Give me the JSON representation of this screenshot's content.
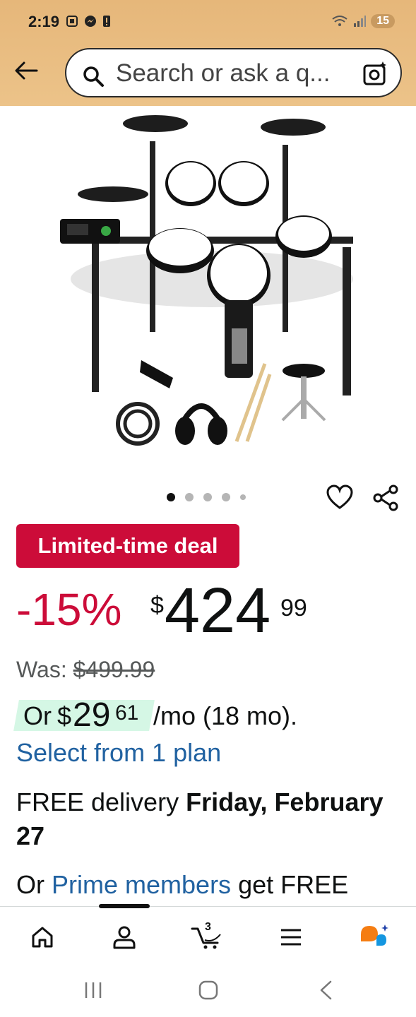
{
  "status_bar": {
    "time": "2:19",
    "battery": "15"
  },
  "search": {
    "placeholder": "Search or ask a q..."
  },
  "gallery": {
    "dot_count": 5,
    "active_index": 0
  },
  "deal": {
    "badge": "Limited-time deal",
    "discount": "-15%",
    "currency": "$",
    "price_whole": "424",
    "price_fraction": "99",
    "was_label": "Was:",
    "was_price": "$499.99"
  },
  "monthly": {
    "or": "Or",
    "currency": "$",
    "whole": "29",
    "fraction": "61",
    "term": "/mo (18 mo)."
  },
  "plan_link": "Select from 1 plan",
  "delivery": {
    "prefix": "FREE delivery",
    "date": "Friday, February 27"
  },
  "prime": {
    "or": "Or",
    "link": "Prime members",
    "suffix": "get FREE"
  },
  "nav": {
    "cart_count": "3"
  },
  "colors": {
    "header": "#e8bb7e",
    "deal_red": "#cc0c39",
    "link_blue": "#2162a1",
    "monthly_green": "#d5f7e5"
  }
}
